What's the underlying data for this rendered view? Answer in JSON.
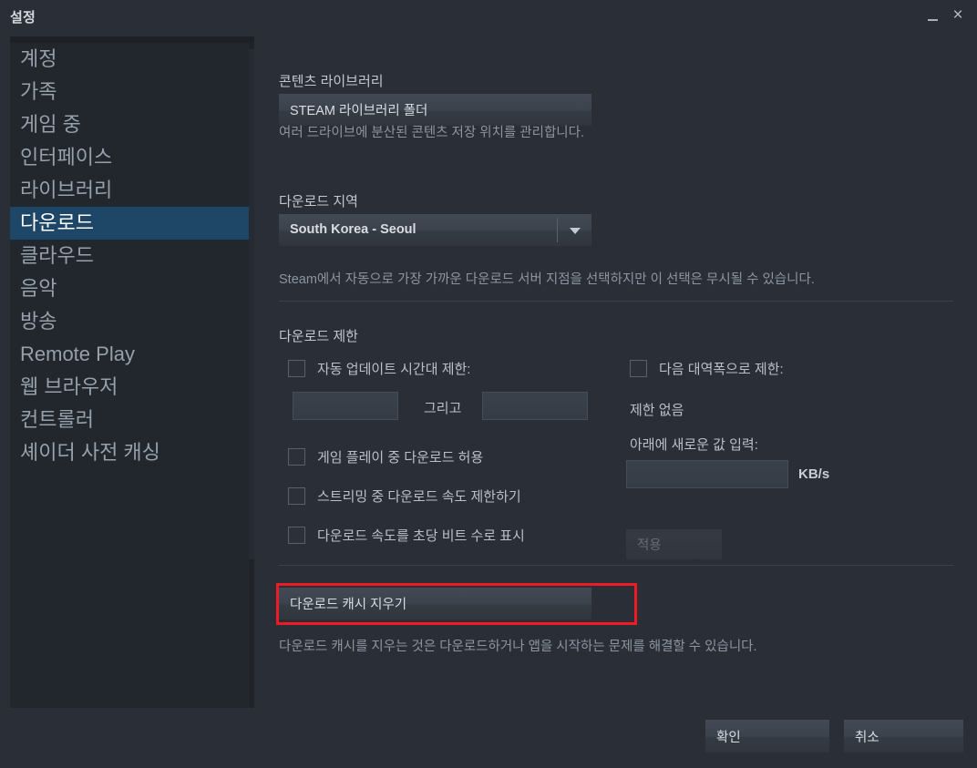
{
  "window": {
    "title": "설정",
    "minimize_icon": "minimize-icon",
    "close_icon": "close-icon",
    "close_glyph": "×"
  },
  "sidebar": {
    "items": [
      {
        "label": "계정",
        "selected": false
      },
      {
        "label": "가족",
        "selected": false
      },
      {
        "label": "게임 중",
        "selected": false
      },
      {
        "label": "인터페이스",
        "selected": false
      },
      {
        "label": "라이브러리",
        "selected": false
      },
      {
        "label": "다운로드",
        "selected": true
      },
      {
        "label": "클라우드",
        "selected": false
      },
      {
        "label": "음악",
        "selected": false
      },
      {
        "label": "방송",
        "selected": false
      },
      {
        "label": "Remote Play",
        "selected": false
      },
      {
        "label": "웹 브라우저",
        "selected": false
      },
      {
        "label": "컨트롤러",
        "selected": false
      },
      {
        "label": "셰이더 사전 캐싱",
        "selected": false
      }
    ]
  },
  "content": {
    "content_library": {
      "heading": "콘텐츠 라이브러리",
      "button_label": "STEAM 라이브러리 폴더",
      "description": "여러 드라이브에 분산된 콘텐츠 저장 위치를 관리합니다."
    },
    "download_region": {
      "heading": "다운로드 지역",
      "selected_value": "South Korea - Seoul",
      "description": "Steam에서 자동으로 가장 가까운 다운로드 서버 지점을 선택하지만 이 선택은 무시될 수 있습니다."
    },
    "download_restrictions": {
      "heading": "다운로드 제한",
      "auto_update_window": {
        "label": "자동 업데이트 시간대 제한:",
        "checked": false,
        "start_value": "",
        "between_label": "그리고",
        "end_value": ""
      },
      "allow_downloads_during_gameplay": {
        "label": "게임 플레이 중 다운로드 허용",
        "checked": false
      },
      "throttle_while_streaming": {
        "label": "스트리밍 중 다운로드 속도 제한하기",
        "checked": false
      },
      "display_rate_in_bits": {
        "label": "다운로드 속도를 초당 비트 수로 표시",
        "checked": false
      },
      "bandwidth_limit": {
        "label": "다음 대역폭으로 제한:",
        "checked": false,
        "current_status": "제한 없음",
        "enter_new_value_label": "아래에 새로운 값 입력:",
        "value": "",
        "unit": "KB/s",
        "apply_label": "적용",
        "apply_disabled": true
      }
    },
    "clear_cache": {
      "button_label": "다운로드 캐시 지우기",
      "description": "다운로드 캐시를 지우는 것은 다운로드하거나 앱을 시작하는 문제를 해결할 수 있습니다."
    }
  },
  "footer": {
    "ok_label": "확인",
    "cancel_label": "취소"
  },
  "colors": {
    "accent_selected": "#1d4667",
    "annotation_red": "#ee1b24",
    "window_bg": "#2a2e36",
    "sidebar_bg": "#22262d"
  }
}
